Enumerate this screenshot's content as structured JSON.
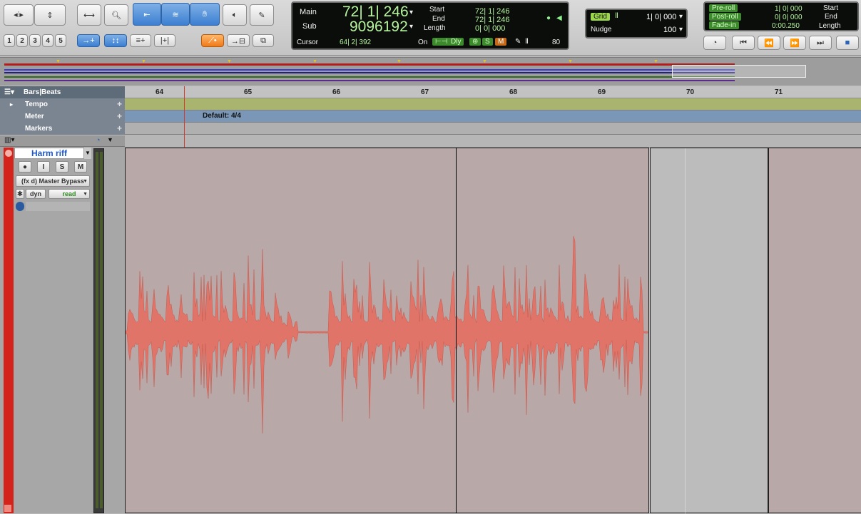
{
  "toolbar": {
    "numbers": [
      "1",
      "2",
      "3",
      "4",
      "5"
    ],
    "counter": {
      "main_label": "Main",
      "main_value": "72| 1| 246",
      "sub_label": "Sub",
      "sub_value": "9096192",
      "cursor_label": "Cursor",
      "cursor_value": "64| 2| 392",
      "start_label": "Start",
      "start_value": "72| 1| 246",
      "end_label": "End",
      "end_value": "72| 1| 246",
      "length_label": "Length",
      "length_value": "0| 0| 000",
      "on_label": "On",
      "dly_label": "Dly",
      "s_label": "S",
      "m_label": "M",
      "value_80": "80"
    },
    "grid": {
      "grid_label": "Grid",
      "grid_value": "1| 0| 000",
      "nudge_label": "Nudge",
      "nudge_value": "100"
    },
    "transport": {
      "preroll_label": "Pre-roll",
      "preroll_value": "1| 0| 000",
      "postroll_label": "Post-roll",
      "postroll_value": "0| 0| 000",
      "fadein_label": "Fade-in",
      "fadein_value": "0:00.250",
      "start_label": "Start",
      "end_label": "End",
      "length_label": "Length"
    }
  },
  "rulers": {
    "bars_label": "Bars|Beats",
    "bars": [
      "64",
      "65",
      "66",
      "67",
      "68",
      "69",
      "70",
      "71"
    ],
    "tempo_label": "Tempo",
    "meter_label": "Meter",
    "meter_value": "Default: 4/4",
    "markers_label": "Markers"
  },
  "track": {
    "name": "Harm riff",
    "rec": "●",
    "input": "I",
    "solo": "S",
    "mute": "M",
    "fx": "(fx d) Master Bypass",
    "automation_type": "dyn",
    "automation_mode": "read"
  },
  "colors": {
    "waveform": "#e07468",
    "region": "#b9a8a8",
    "track_color": "#d4231a",
    "tempo_ruler": "#a9b56f",
    "meter_ruler": "#7a97b8"
  }
}
